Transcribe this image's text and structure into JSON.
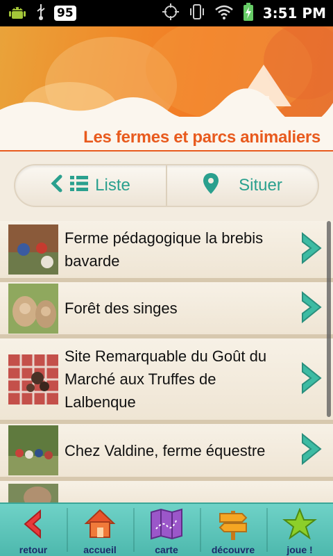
{
  "status_bar": {
    "battery_level": "95",
    "time": "3:51 PM"
  },
  "header": {
    "title": "Les fermes et parcs animaliers"
  },
  "toggle": {
    "list_label": "Liste",
    "map_label": "Situer"
  },
  "items": [
    {
      "title": "Ferme pédagogique la brebis bavarde"
    },
    {
      "title": "Forêt des singes"
    },
    {
      "title": "Site Remarquable du Goût du Marché aux Truffes de Lalbenque"
    },
    {
      "title": "Chez Valdine, ferme équestre"
    },
    {
      "title": ""
    }
  ],
  "bottom_nav": [
    {
      "label": "retour",
      "icon": "chevron-left-icon"
    },
    {
      "label": "accueil",
      "icon": "home-icon"
    },
    {
      "label": "carte",
      "icon": "map-icon"
    },
    {
      "label": "découvre",
      "icon": "signpost-icon"
    },
    {
      "label": "joue !",
      "icon": "star-icon"
    }
  ],
  "colors": {
    "accent": "#2aa08e",
    "title": "#e85a1d",
    "nav_bar": "#5cc6bb"
  }
}
